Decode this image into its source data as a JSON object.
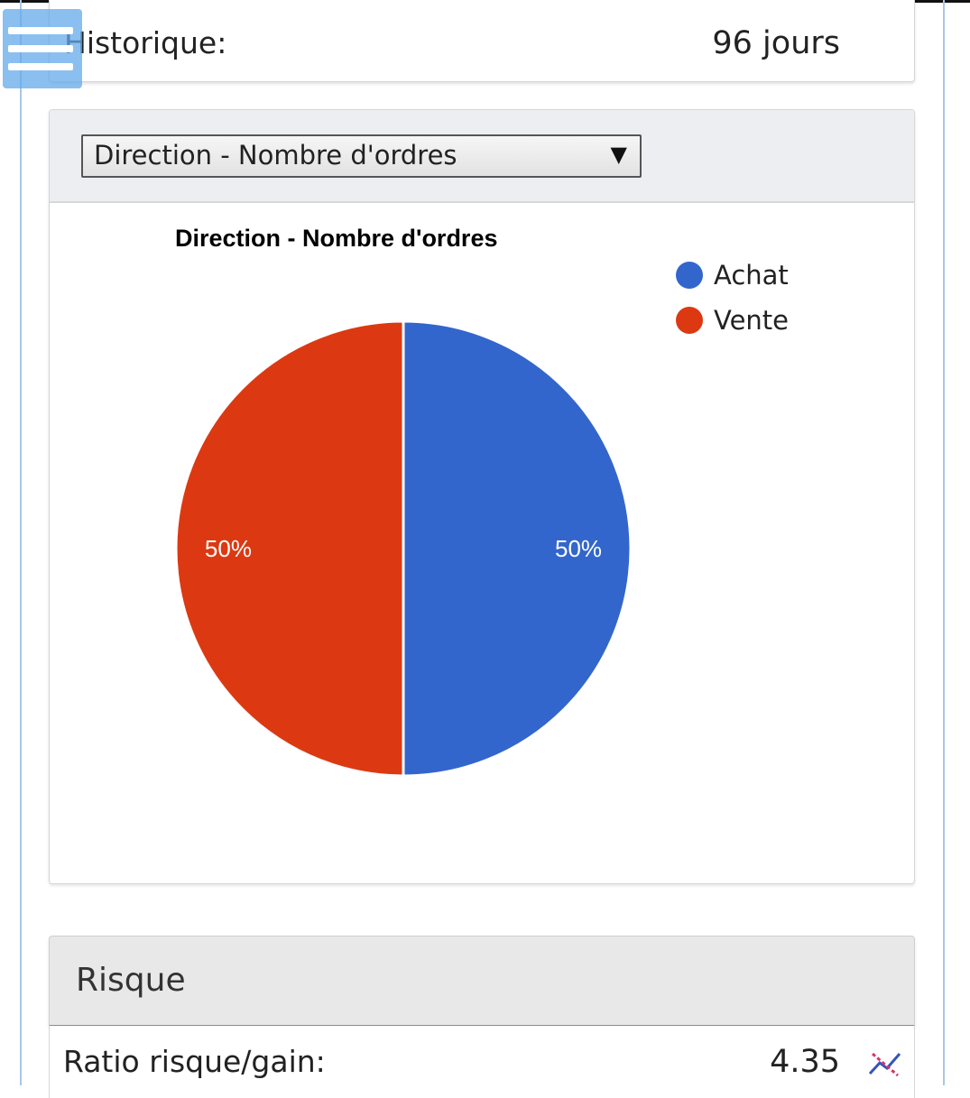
{
  "header": {
    "menu_icon": "hamburger-menu-icon"
  },
  "history": {
    "label": "Historique:",
    "value": "96 jours"
  },
  "chart_panel": {
    "select": {
      "selected": "Direction - Nombre d'ordres"
    }
  },
  "chart_data": {
    "type": "pie",
    "title": "Direction - Nombre d'ordres",
    "categories": [
      "Achat",
      "Vente"
    ],
    "values": [
      50,
      50
    ],
    "value_labels": [
      "50%",
      "50%"
    ],
    "colors": [
      "#3366cc",
      "#dc3912"
    ],
    "legend": "top-right"
  },
  "risk": {
    "title": "Risque",
    "ratio": {
      "label": "Ratio risque/gain:",
      "value": "4.35",
      "icon": "trend-chart-icon"
    }
  }
}
